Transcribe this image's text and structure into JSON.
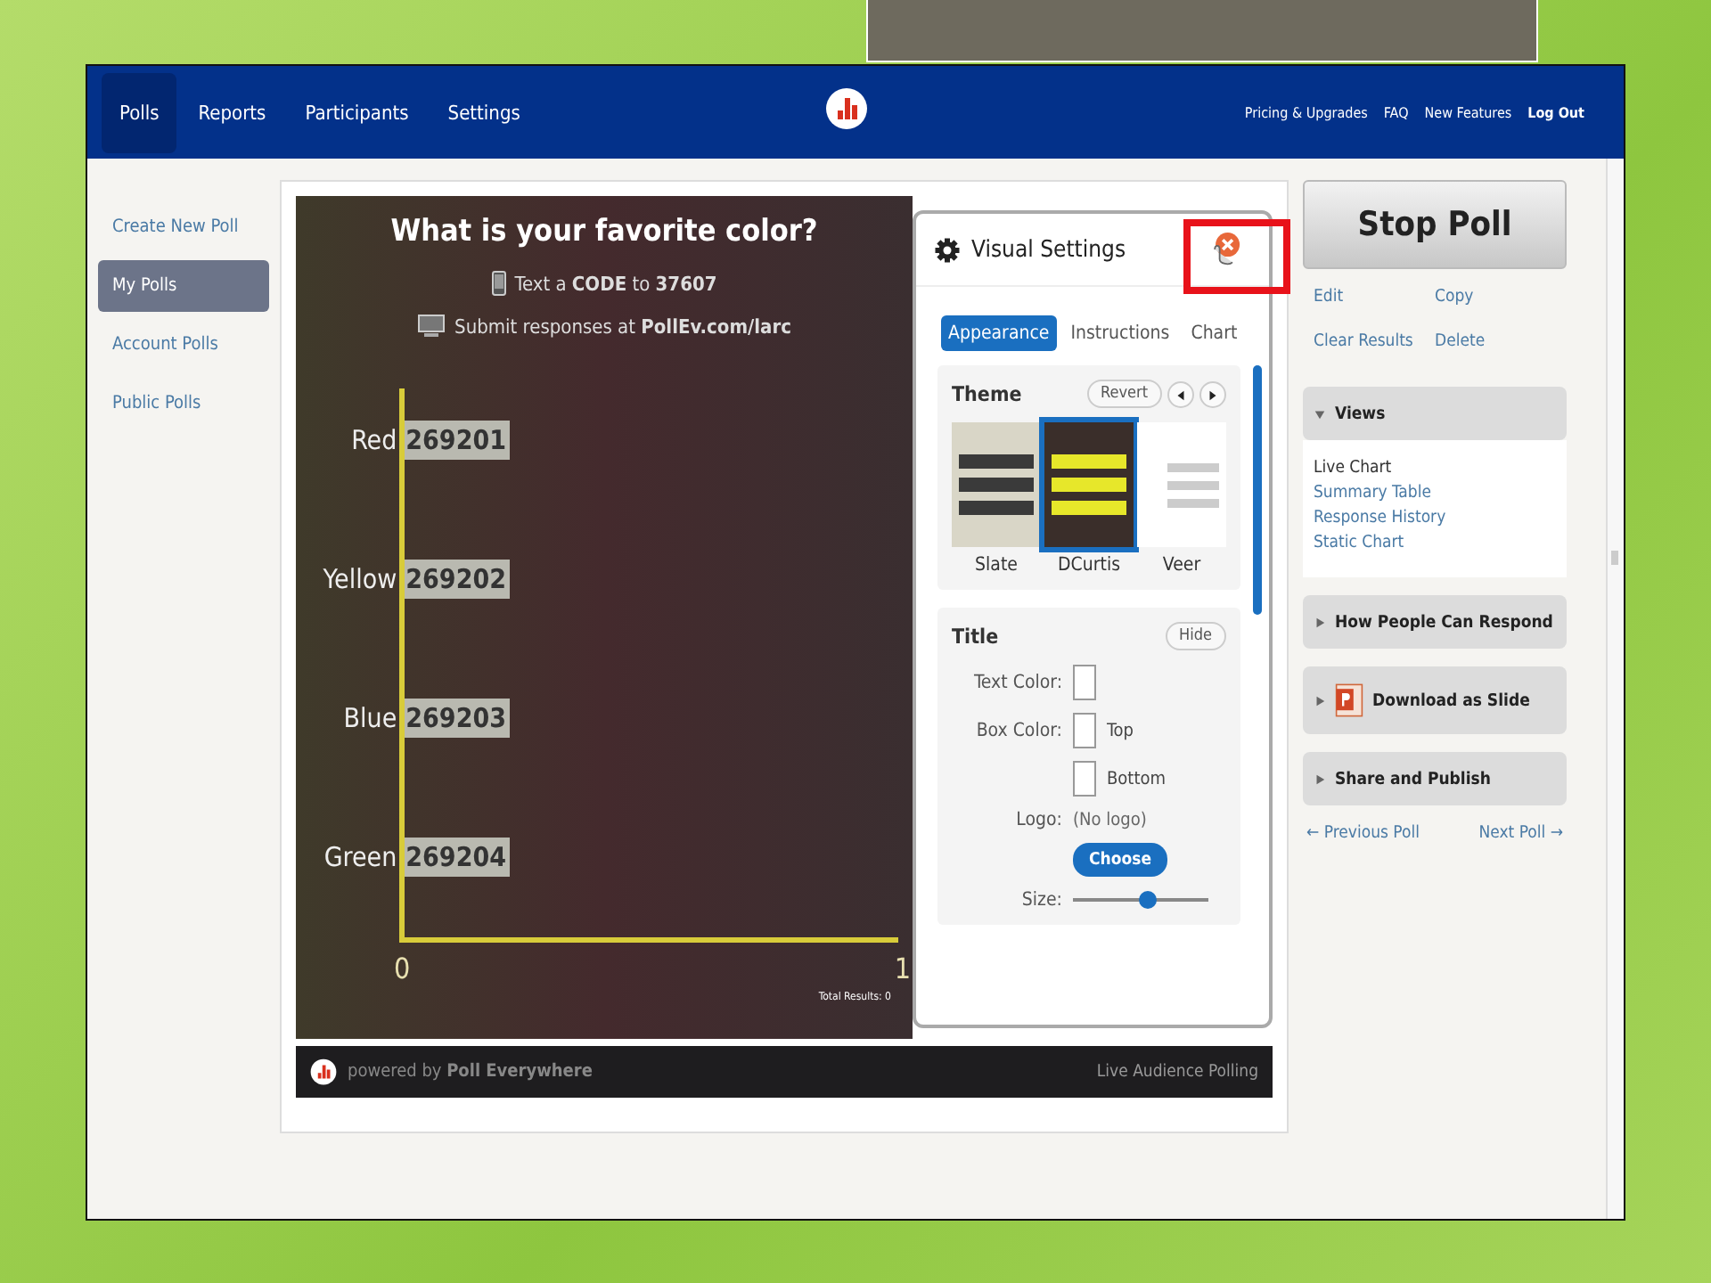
{
  "nav": {
    "tabs": [
      {
        "label": "Polls",
        "selected": true
      },
      {
        "label": "Reports",
        "selected": false
      },
      {
        "label": "Participants",
        "selected": false
      },
      {
        "label": "Settings",
        "selected": false
      }
    ],
    "links": [
      "Pricing & Upgrades",
      "FAQ",
      "New Features",
      "Log Out"
    ]
  },
  "sidebar": {
    "items": [
      {
        "label": "Create New Poll",
        "selected": false
      },
      {
        "label": "My Polls",
        "selected": true
      },
      {
        "label": "Account Polls",
        "selected": false
      },
      {
        "label": "Public Polls",
        "selected": false
      }
    ]
  },
  "poll": {
    "question": "What is your favorite color?",
    "text_instruction": "Text a **CODE** to **37607**",
    "web_instruction": "Submit responses at **PollEv.com/larc**",
    "rows": [
      {
        "label": "Red",
        "code": "269201"
      },
      {
        "label": "Yellow",
        "code": "269202"
      },
      {
        "label": "Blue",
        "code": "269203"
      },
      {
        "label": "Green",
        "code": "269204"
      }
    ],
    "axis_ticks": [
      "0",
      "1"
    ],
    "total": "Total Results: 0",
    "footer": {
      "powered": "powered by **Poll Everywhere**",
      "tagline": "Live Audience Polling"
    }
  },
  "visual_settings": {
    "title": "Visual Settings",
    "tabs": [
      {
        "label": "Appearance",
        "selected": true
      },
      {
        "label": "Instructions",
        "selected": false
      },
      {
        "label": "Chart",
        "selected": false
      }
    ],
    "theme": {
      "title": "Theme",
      "revert": "Revert",
      "themes": [
        {
          "name": "Slate",
          "selected": false
        },
        {
          "name": "DCurtis",
          "selected": true
        },
        {
          "name": "Veer",
          "selected": false
        }
      ]
    },
    "title_section": {
      "title": "Title",
      "hide": "Hide",
      "text_color": "Text Color:",
      "box_color": "Box Color:",
      "top": "Top",
      "bottom": "Bottom",
      "logo": "Logo:",
      "logo_value": "(No logo)",
      "choose": "Choose",
      "size": "Size:",
      "size_slider": {
        "level": 0.55
      }
    }
  },
  "actions": {
    "stop": "Stop Poll",
    "links": [
      "Edit",
      "Copy",
      "Clear Results",
      "Delete"
    ]
  },
  "panels": [
    {
      "kind": "views",
      "title": "Views",
      "expanded": true,
      "items": [
        {
          "label": "Live Chart",
          "selected": true
        },
        {
          "label": "Summary Table",
          "selected": false
        },
        {
          "label": "Response History",
          "selected": false
        },
        {
          "label": "Static Chart",
          "selected": false
        }
      ]
    },
    {
      "kind": "plain",
      "title": "How People Can Respond",
      "expanded": false
    },
    {
      "kind": "slide",
      "title": "Download as Slide",
      "expanded": false
    },
    {
      "kind": "plain",
      "title": "Share and Publish",
      "expanded": false
    }
  ],
  "pager": {
    "previous": "← Previous Poll",
    "next": "Next Poll →"
  }
}
